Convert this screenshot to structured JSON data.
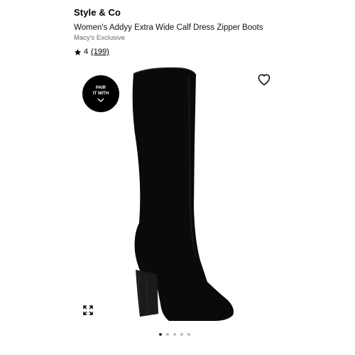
{
  "product": {
    "brand": "Style & Co",
    "name": "Women's Addyy Extra Wide Calf Dress Zipper Boots",
    "exclusive": "Macy's Exclusive",
    "rating": "4",
    "review_count": "(199)"
  },
  "pair_badge": {
    "line1": "PAIR",
    "line2": "IT WITH"
  },
  "icons": {
    "favorite": "heart-icon",
    "expand": "expand-icon",
    "rating": "star-icon",
    "pair": "chevron-down-icon"
  },
  "carousel": {
    "total_images": 5,
    "active_index": 0
  },
  "colors": {
    "product": "#0a0a0a",
    "heel": "#1b1b1b",
    "dot_active": "#333333",
    "dot_inactive": "#bdbdbd"
  }
}
